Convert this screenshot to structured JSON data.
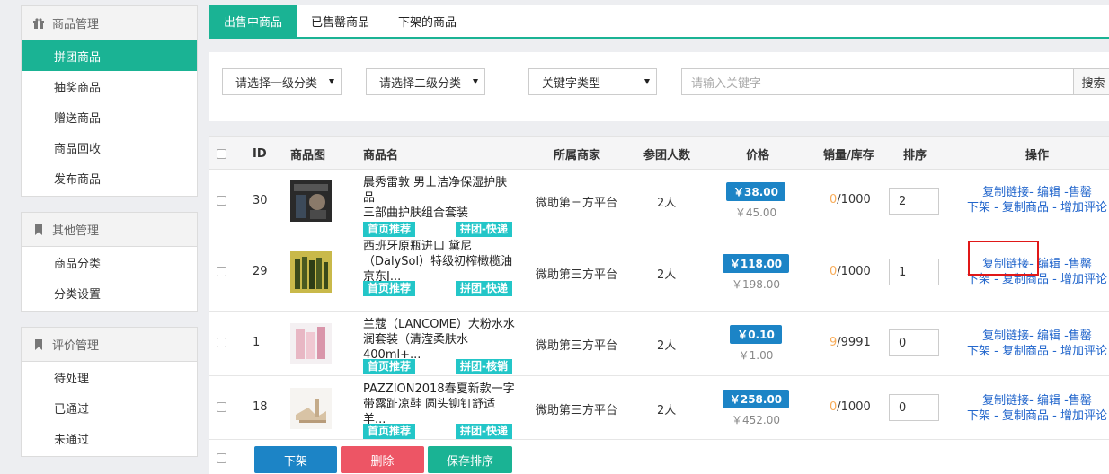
{
  "sidebar": {
    "groups": [
      {
        "title": "商品管理",
        "icon": "gift-icon",
        "items": [
          "拼团商品",
          "抽奖商品",
          "赠送商品",
          "商品回收",
          "发布商品"
        ]
      },
      {
        "title": "其他管理",
        "icon": "bookmark-icon",
        "items": [
          "商品分类",
          "分类设置"
        ]
      },
      {
        "title": "评价管理",
        "icon": "bookmark-icon",
        "items": [
          "待处理",
          "已通过",
          "未通过"
        ]
      }
    ]
  },
  "tabs": [
    "出售中商品",
    "已售罄商品",
    "下架的商品"
  ],
  "filters": {
    "category1": "请选择一级分类",
    "category2": "请选择二级分类",
    "keyword_type": "关键字类型",
    "keyword_placeholder": "请输入关键字",
    "search_label": "搜索"
  },
  "table": {
    "headers": [
      "ID",
      "商品图",
      "商品名",
      "所属商家",
      "参团人数",
      "价格",
      "销量/库存",
      "排序",
      "操作"
    ],
    "rows": [
      {
        "id": "30",
        "name_line1": "晨秀雷敦 男士洁净保湿护肤品",
        "name_line2": "三部曲护肤组合套装",
        "name_line3": "",
        "tag_home": "首页推荐",
        "tag_type": "拼团-快递",
        "merchant": "微助第三方平台",
        "group_size": "2人",
        "price": "￥38.00",
        "orig_price": "￥45.00",
        "sold": "0",
        "stock": "/1000",
        "sort": "2"
      },
      {
        "id": "29",
        "name_line1": "西班牙原瓶进口 黛尼",
        "name_line2": "（DalySol）特级初榨橄榄油",
        "name_line3": "京东J...",
        "tag_home": "首页推荐",
        "tag_type": "拼团-快递",
        "merchant": "微助第三方平台",
        "group_size": "2人",
        "price": "￥118.00",
        "orig_price": "￥198.00",
        "sold": "0",
        "stock": "/1000",
        "sort": "1"
      },
      {
        "id": "1",
        "name_line1": "兰蔻（LANCOME）大粉水水",
        "name_line2": "润套装（清滢柔肤水400ml+...",
        "name_line3": "",
        "tag_home": "首页推荐",
        "tag_type": "拼团-核销",
        "merchant": "微助第三方平台",
        "group_size": "2人",
        "price": "￥0.10",
        "orig_price": "￥1.00",
        "sold": "9",
        "stock": "/9991",
        "sort": "0"
      },
      {
        "id": "18",
        "name_line1": "PAZZION2018春夏新款一字",
        "name_line2": "带露趾凉鞋 圆头铆钉舒适羊...",
        "name_line3": "",
        "tag_home": "首页推荐",
        "tag_type": "拼团-快递",
        "merchant": "微助第三方平台",
        "group_size": "2人",
        "price": "￥258.00",
        "orig_price": "￥452.00",
        "sold": "0",
        "stock": "/1000",
        "sort": "0"
      }
    ],
    "ops": {
      "copy_link": "复制链接",
      "edit": "编辑",
      "sold_out": "售罄",
      "offline": "下架",
      "copy_goods": "复制商品",
      "add_review": "增加评论"
    }
  },
  "bulk": {
    "offline": "下架",
    "delete": "删除",
    "save_sort": "保存排序"
  },
  "colors": {
    "accent": "#1ab394",
    "price": "#1c84c6",
    "tag": "#23c6c8",
    "danger": "#ed5565",
    "link": "#2266cc"
  }
}
